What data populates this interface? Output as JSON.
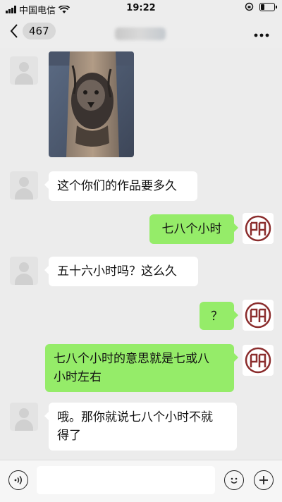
{
  "status_bar": {
    "carrier": "中国电信",
    "time": "19:22"
  },
  "nav": {
    "unread_count": "467"
  },
  "messages": [
    {
      "side": "left",
      "type": "image",
      "image": "tattoo-lion-forearm"
    },
    {
      "side": "left",
      "type": "text",
      "text": "这个你们的作品要多久"
    },
    {
      "side": "right",
      "type": "text",
      "text": "七八个小时"
    },
    {
      "side": "left",
      "type": "text",
      "text": "五十六小时吗？这么久"
    },
    {
      "side": "right",
      "type": "text",
      "text": "？"
    },
    {
      "side": "right",
      "type": "text",
      "line1": "七八个小时的意思就是七或八",
      "line2": "小时左右"
    },
    {
      "side": "left",
      "type": "text",
      "line1": "哦。那你就说七八个小时不就",
      "line2": "得了"
    }
  ],
  "colors": {
    "background": "#ececec",
    "bubble_out": "#95ec69",
    "bubble_in": "#ffffff",
    "avatar_logo": "#8b2d2d"
  },
  "icons": {
    "voice": "voice-icon",
    "emoji": "emoji-icon",
    "plus": "plus-icon"
  }
}
